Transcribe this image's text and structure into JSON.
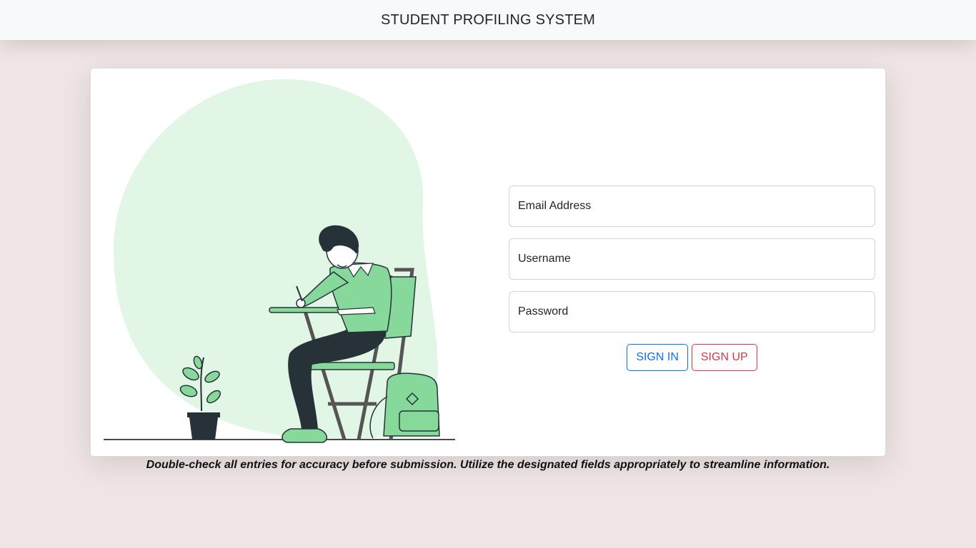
{
  "header": {
    "title": "STUDENT PROFILING SYSTEM"
  },
  "form": {
    "email_placeholder": "Email Address",
    "username_placeholder": "Username",
    "password_placeholder": "Password",
    "signin_label": "SIGN IN",
    "signup_label": "SIGN UP"
  },
  "footer_note": "Double-check all entries for accuracy before submission. Utilize the designated fields appropriately to streamline information.",
  "colors": {
    "background": "#efe5e4",
    "blob": "#e2f6e6",
    "accent_green": "#86d99a",
    "signin": "#0d6efd",
    "signup": "#dc3545"
  },
  "icons": {
    "illustration": "student-writing-illustration"
  }
}
